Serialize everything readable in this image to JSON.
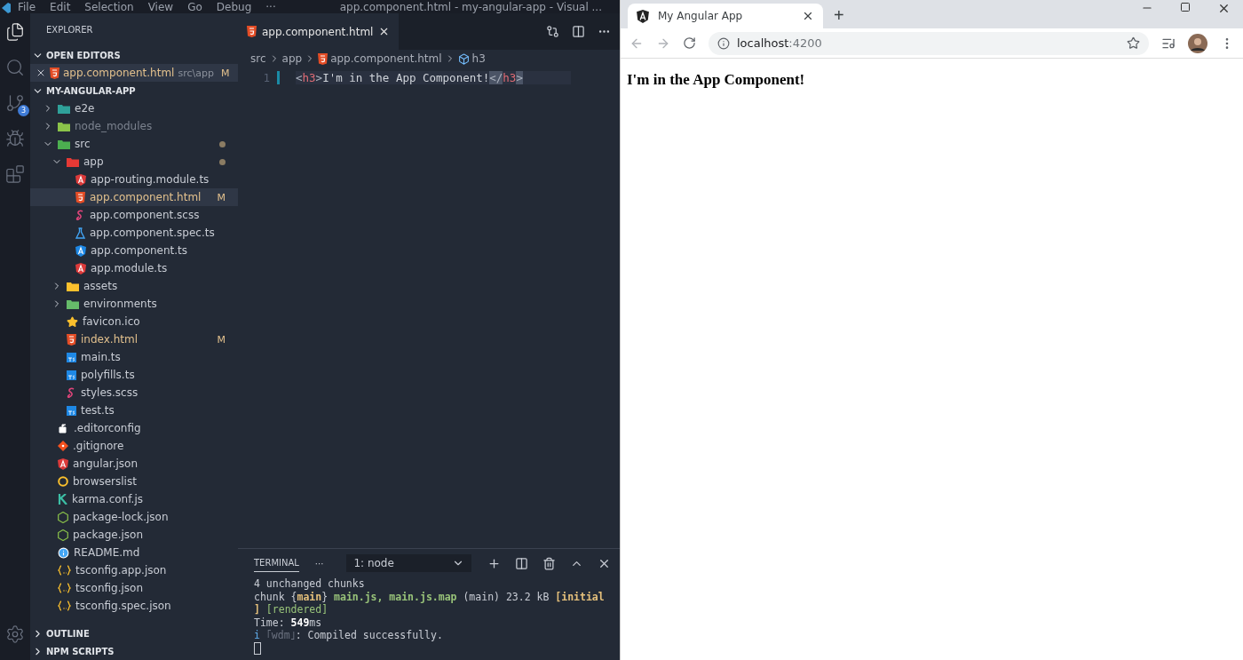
{
  "vscode": {
    "menu": [
      "File",
      "Edit",
      "Selection",
      "View",
      "Go",
      "Debug",
      "···"
    ],
    "window_title": "app.component.html - my-angular-app - Visual ...",
    "activity_items": [
      {
        "kind": "files",
        "selected": true
      },
      {
        "kind": "search",
        "selected": false
      },
      {
        "kind": "source-control",
        "selected": false,
        "badge": "3"
      },
      {
        "kind": "debug",
        "selected": false
      },
      {
        "kind": "extensions",
        "selected": false
      }
    ],
    "sidebar": {
      "title": "EXPLORER",
      "open_editors": {
        "label": "OPEN EDITORS",
        "expanded": true,
        "items": [
          {
            "name": "app.component.html",
            "kind": "html",
            "path": "src\\app",
            "status": "M",
            "selected": true
          }
        ]
      },
      "project": {
        "label": "MY-ANGULAR-APP",
        "expanded": true,
        "tree": [
          {
            "name": "e2e",
            "kind": "folder-e2e",
            "expanded": false,
            "dimmed": false,
            "selected": false
          },
          {
            "name": "node_modules",
            "kind": "folder-node",
            "expanded": false,
            "dimmed": true,
            "selected": false
          },
          {
            "name": "src",
            "kind": "folder-src",
            "expanded": true,
            "changes": true,
            "dimmed": false,
            "selected": false,
            "children": [
              {
                "name": "app",
                "kind": "folder-app",
                "expanded": true,
                "changes": true,
                "dimmed": false,
                "selected": false,
                "children": [
                  {
                    "name": "app-routing.module.ts",
                    "kind": "angular",
                    "dimmed": false,
                    "selected": false
                  },
                  {
                    "name": "app.component.html",
                    "kind": "html",
                    "status": "M",
                    "dimmed": false,
                    "selected": true
                  },
                  {
                    "name": "app.component.scss",
                    "kind": "scss",
                    "dimmed": false,
                    "selected": false
                  },
                  {
                    "name": "app.component.spec.ts",
                    "kind": "test",
                    "dimmed": false,
                    "selected": false
                  },
                  {
                    "name": "app.component.ts",
                    "kind": "angular-component",
                    "dimmed": false,
                    "selected": false
                  },
                  {
                    "name": "app.module.ts",
                    "kind": "angular",
                    "dimmed": false,
                    "selected": false
                  }
                ]
              },
              {
                "name": "assets",
                "kind": "folder-assets",
                "expanded": false,
                "dimmed": false,
                "selected": false
              },
              {
                "name": "environments",
                "kind": "folder-env",
                "expanded": false,
                "dimmed": false,
                "selected": false
              },
              {
                "name": "favicon.ico",
                "kind": "star",
                "dimmed": false,
                "selected": false
              },
              {
                "name": "index.html",
                "kind": "html",
                "status": "M",
                "dimmed": false,
                "selected": false
              },
              {
                "name": "main.ts",
                "kind": "ts",
                "dimmed": false,
                "selected": false
              },
              {
                "name": "polyfills.ts",
                "kind": "ts",
                "dimmed": false,
                "selected": false
              },
              {
                "name": "styles.scss",
                "kind": "scss",
                "dimmed": false,
                "selected": false
              },
              {
                "name": "test.ts",
                "kind": "ts",
                "dimmed": false,
                "selected": false
              }
            ]
          },
          {
            "name": ".editorconfig",
            "kind": "editorconfig",
            "dimmed": false,
            "selected": false
          },
          {
            "name": ".gitignore",
            "kind": "git",
            "dimmed": false,
            "selected": false
          },
          {
            "name": "angular.json",
            "kind": "angular",
            "dimmed": false,
            "selected": false
          },
          {
            "name": "browserslist",
            "kind": "browserslist",
            "dimmed": false,
            "selected": false
          },
          {
            "name": "karma.conf.js",
            "kind": "karma",
            "dimmed": false,
            "selected": false
          },
          {
            "name": "package-lock.json",
            "kind": "node",
            "dimmed": false,
            "selected": false
          },
          {
            "name": "package.json",
            "kind": "node",
            "dimmed": false,
            "selected": false
          },
          {
            "name": "README.md",
            "kind": "info",
            "dimmed": false,
            "selected": false
          },
          {
            "name": "tsconfig.app.json",
            "kind": "json",
            "dimmed": false,
            "selected": false
          },
          {
            "name": "tsconfig.json",
            "kind": "json",
            "dimmed": false,
            "selected": false
          },
          {
            "name": "tsconfig.spec.json",
            "kind": "json",
            "dimmed": false,
            "selected": false
          }
        ]
      },
      "bottom_sections": [
        {
          "label": "OUTLINE",
          "expanded": false
        },
        {
          "label": "NPM SCRIPTS",
          "expanded": false
        }
      ]
    },
    "editor": {
      "tab": {
        "label": "app.component.html",
        "kind": "html"
      },
      "breadcrumb": [
        {
          "label": "src",
          "kind": "folder"
        },
        {
          "label": "app",
          "kind": "folder"
        },
        {
          "label": "app.component.html",
          "kind": "html"
        },
        {
          "label": "h3",
          "kind": "element"
        }
      ],
      "lines": [
        {
          "number": "1",
          "tokens": [
            {
              "text": "<",
              "kind": "punct",
              "match": false
            },
            {
              "text": "h3",
              "kind": "tag",
              "match": false
            },
            {
              "text": ">",
              "kind": "punct",
              "match": false
            },
            {
              "text": "I'm in the App Component!",
              "kind": "text",
              "match": false
            },
            {
              "text": "</",
              "kind": "punct",
              "match": true
            },
            {
              "text": "h3",
              "kind": "tag",
              "match": false
            },
            {
              "text": ">",
              "kind": "punct",
              "match": true
            }
          ]
        }
      ]
    },
    "terminal": {
      "tab": "TERMINAL",
      "more": "···",
      "shell": "1: node",
      "lines": [
        [
          {
            "text": "4 unchanged chunks",
            "kind": "plain"
          }
        ],
        [
          {
            "text": "chunk {",
            "kind": "plain"
          },
          {
            "text": "main",
            "kind": "yellow-bold"
          },
          {
            "text": "} ",
            "kind": "plain"
          },
          {
            "text": "main.js, main.js.map",
            "kind": "green-bold"
          },
          {
            "text": " (main) 23.2 kB ",
            "kind": "plain"
          },
          {
            "text": "[initial",
            "kind": "yellow-bold"
          }
        ],
        [
          {
            "text": "] ",
            "kind": "yellow-bold"
          },
          {
            "text": "[rendered]",
            "kind": "green"
          }
        ],
        [
          {
            "text": "Time: ",
            "kind": "plain"
          },
          {
            "text": "549",
            "kind": "bold"
          },
          {
            "text": "ms",
            "kind": "plain"
          }
        ],
        [
          {
            "text": "i",
            "kind": "blue"
          },
          {
            "text": " ｢wdm｣",
            "kind": "dim"
          },
          {
            "text": ": Compiled successfully.",
            "kind": "plain"
          }
        ]
      ]
    }
  },
  "browser": {
    "tab": {
      "title": "My Angular App",
      "selected": true
    },
    "new_tab": "+",
    "url": [
      {
        "text": "localhost",
        "kind": "host"
      },
      {
        "text": ":4200",
        "kind": "port"
      }
    ],
    "page": {
      "heading": "I'm in the App Component!"
    }
  }
}
